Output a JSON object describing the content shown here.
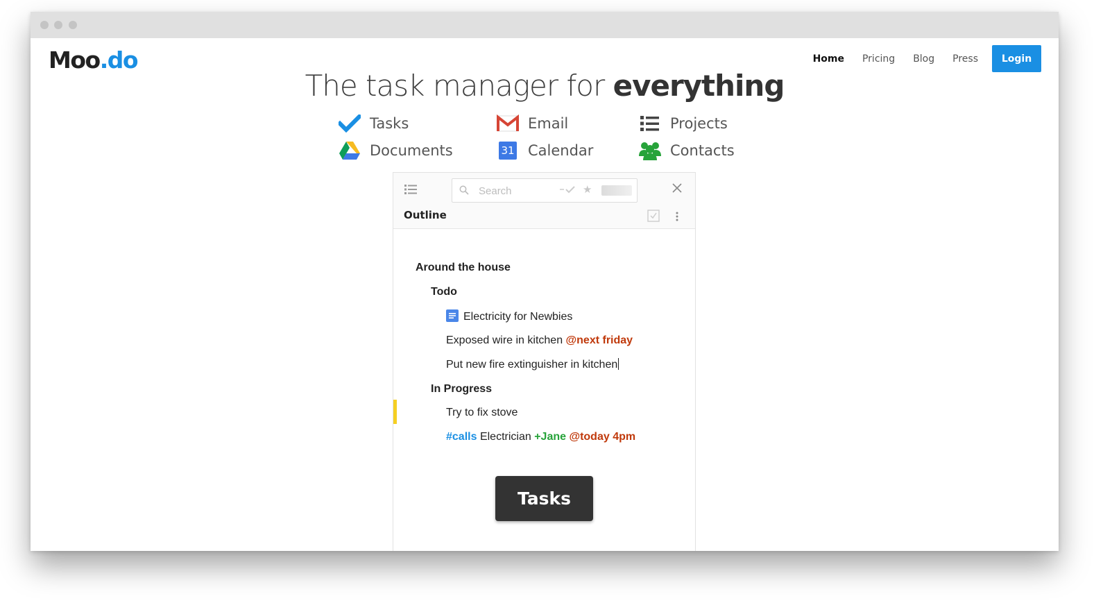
{
  "logo": {
    "text_a": "Moo",
    "text_b": ".do"
  },
  "nav": {
    "home": "Home",
    "pricing": "Pricing",
    "blog": "Blog",
    "press": "Press",
    "login": "Login"
  },
  "headline": {
    "regular": "The task manager for",
    "bold": "everything"
  },
  "features": {
    "tasks": "Tasks",
    "email": "Email",
    "projects": "Projects",
    "documents": "Documents",
    "calendar": "Calendar",
    "calendar_day": "31",
    "contacts": "Contacts"
  },
  "app": {
    "search_placeholder": "Search",
    "outline_title": "Outline",
    "items": {
      "group": "Around the house",
      "todo": "Todo",
      "doc": "Electricity for Newbies",
      "wire": "Exposed wire in kitchen",
      "wire_due": "@next friday",
      "extinguisher": "Put new fire extinguisher in kitchen",
      "in_progress": "In Progress",
      "stove": "Try to fix stove",
      "calls_tag": "#calls",
      "electrician": "Electrician",
      "jane": "+Jane",
      "today_due": "@today 4pm"
    }
  },
  "tooltip": {
    "label": "Tasks"
  },
  "colors": {
    "accent": "#1a8fe3",
    "due": "#c0390b",
    "person": "#27a33a",
    "flag": "#f5cf22"
  }
}
